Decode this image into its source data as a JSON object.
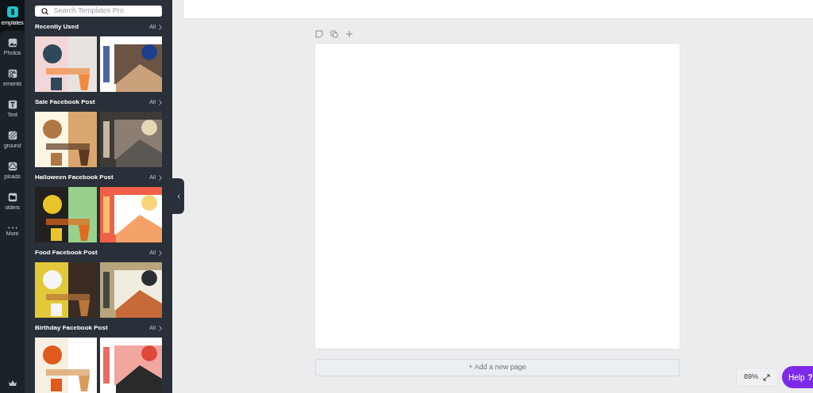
{
  "rail": {
    "items": [
      {
        "label": "emplates",
        "selected": true
      },
      {
        "label": "Photos",
        "selected": false
      },
      {
        "label": "ements",
        "selected": false
      },
      {
        "label": "Text",
        "selected": false
      },
      {
        "label": "ground",
        "selected": false
      },
      {
        "label": "ploads",
        "selected": false
      },
      {
        "label": "olders",
        "selected": false
      },
      {
        "label": "More",
        "selected": false
      }
    ]
  },
  "panel": {
    "search": {
      "placeholder": "Search Templates Pro"
    },
    "sections": [
      {
        "title": "Recently Used",
        "link": "All"
      },
      {
        "title": "Sale Facebook Post",
        "link": "All"
      },
      {
        "title": "Halloween Facebook Post",
        "link": "All"
      },
      {
        "title": "Food Facebook Post",
        "link": "All"
      },
      {
        "title": "Birthday Facebook Post",
        "link": "All"
      }
    ]
  },
  "canvas": {
    "add_page": "+ Add a new page",
    "zoom": "89%"
  },
  "help": {
    "label": "Help",
    "icon_text": "?"
  }
}
